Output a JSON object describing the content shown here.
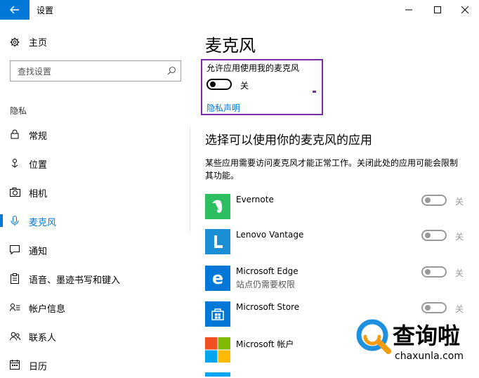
{
  "window": {
    "title": "设置",
    "minimize": "—",
    "maximize": "☐",
    "close": "✕"
  },
  "sidebar": {
    "home_label": "主页",
    "search_placeholder": "查找设置",
    "section_label": "隐私",
    "items": [
      {
        "label": "常规",
        "icon": "lock-icon"
      },
      {
        "label": "位置",
        "icon": "location-pin-icon"
      },
      {
        "label": "相机",
        "icon": "camera-icon"
      },
      {
        "label": "麦克风",
        "icon": "microphone-icon",
        "active": true
      },
      {
        "label": "通知",
        "icon": "notification-icon"
      },
      {
        "label": "语音、墨迹书写和键入",
        "icon": "clipboard-icon"
      },
      {
        "label": "帐户信息",
        "icon": "account-info-icon"
      },
      {
        "label": "联系人",
        "icon": "contacts-icon"
      },
      {
        "label": "日历",
        "icon": "calendar-icon"
      }
    ]
  },
  "main": {
    "title": "麦克风",
    "allow_label": "允许应用使用我的麦克风",
    "allow_state": "关",
    "privacy_link": "隐私声明",
    "choose_heading": "选择可以使用你的麦克风的应用",
    "description": "某些应用需要访问麦克风才能正常工作。关闭此处的应用可能会限制其功能。",
    "apps": [
      {
        "name": "Evernote",
        "sub": "",
        "state": "关",
        "icon_color": "#2dbe60"
      },
      {
        "name": "Lenovo Vantage",
        "sub": "",
        "state": "关",
        "icon_color": "#1a8fd6"
      },
      {
        "name": "Microsoft Edge",
        "sub": "站点仍需要权限",
        "state": "关",
        "icon_color": "#0078d7"
      },
      {
        "name": "Microsoft Store",
        "sub": "",
        "state": "关",
        "icon_color": "#0078d7"
      },
      {
        "name": "Microsoft 帐户",
        "sub": "",
        "state": "",
        "icon_color": "#f25022"
      }
    ]
  },
  "watermark": {
    "brand": "查询啦",
    "domain": "chaxunla.com"
  },
  "colors": {
    "accent": "#0078d7",
    "highlight_box": "#7b2da3"
  }
}
